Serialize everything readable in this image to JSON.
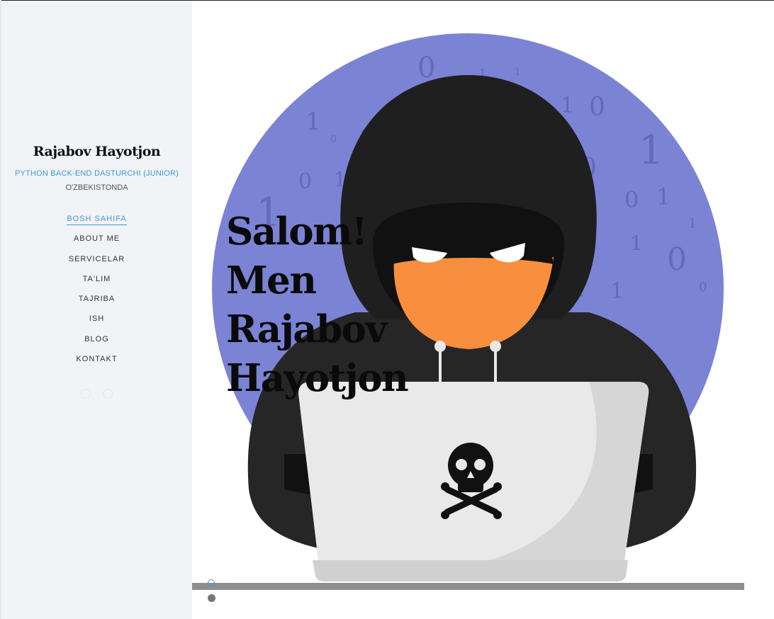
{
  "sidebar": {
    "name": "Rajabov Hayotjon",
    "role": "PYTHON BACK-END DASTURCHI (JUNIOR)",
    "location": "O'ZBEKISTONDA",
    "nav": [
      {
        "label": "BOSH SAHIFA",
        "active": true
      },
      {
        "label": "ABOUT ME"
      },
      {
        "label": "SERVICELAR"
      },
      {
        "label": "TA'LIM"
      },
      {
        "label": "TAJRIBA"
      },
      {
        "label": "ISH"
      },
      {
        "label": "BLOG"
      },
      {
        "label": "KONTAKT"
      }
    ],
    "social_icons": [
      "social-icon-1",
      "social-icon-2"
    ]
  },
  "hero": {
    "lines": [
      "Salom!",
      "Men",
      "Rajabov",
      "Hayotjon"
    ],
    "image": "hacker-illustration",
    "colors": {
      "accent": "#3b9ad9",
      "circle": "#7b83d4",
      "hood": "#1f1f1f",
      "face": "#f78f3f"
    }
  },
  "slider": {
    "dots": 2,
    "active_index": 0
  }
}
